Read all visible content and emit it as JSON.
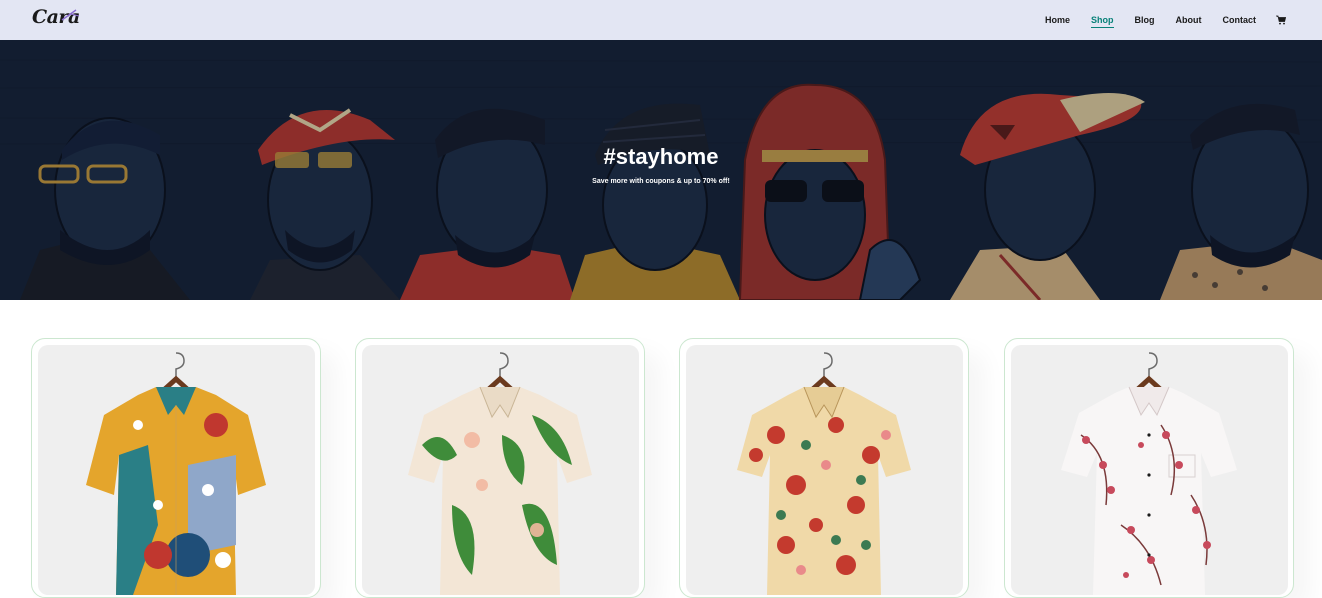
{
  "header": {
    "logo": "Cara",
    "nav": [
      {
        "label": "Home",
        "active": false
      },
      {
        "label": "Shop",
        "active": true
      },
      {
        "label": "Blog",
        "active": false
      },
      {
        "label": "About",
        "active": false
      },
      {
        "label": "Contact",
        "active": false
      }
    ],
    "cart_icon": "cart-icon"
  },
  "hero": {
    "title": "#stayhome",
    "subtitle": "Save more with coupons & up to 70% off!"
  },
  "products": [
    {
      "name": "product-1",
      "icon": "shirt-abstract-floral",
      "colors": [
        "#e4a52c",
        "#2a7f86",
        "#c0372f"
      ]
    },
    {
      "name": "product-2",
      "icon": "shirt-tropical-leaf",
      "colors": [
        "#f3e6d6",
        "#3f8c3a",
        "#f2b8a0"
      ]
    },
    {
      "name": "product-3",
      "icon": "shirt-red-floral",
      "colors": [
        "#f0d9a8",
        "#c43a2e",
        "#3c7a52"
      ]
    },
    {
      "name": "product-4",
      "icon": "shirt-cherry-blossom",
      "colors": [
        "#f8f6f6",
        "#c74a5c",
        "#7a3a3a"
      ]
    }
  ],
  "colors": {
    "header_bg": "#e3e6f3",
    "accent": "#088178",
    "hero_bg": "#152034",
    "card_border": "#cce7d0"
  }
}
